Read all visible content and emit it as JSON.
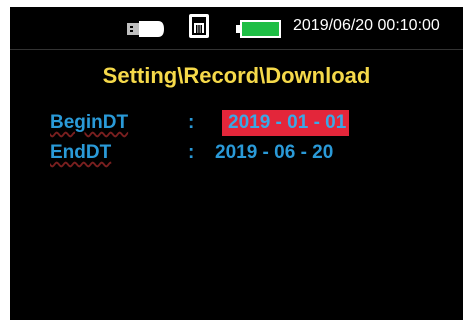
{
  "status_bar": {
    "datetime": "2019/06/20 00:10:00",
    "icons": [
      "usb-drive-icon",
      "sim-card-icon",
      "battery-icon"
    ]
  },
  "page": {
    "title": "Setting\\Record\\Download"
  },
  "fields": [
    {
      "label": "BeginDT",
      "separator": ":",
      "value": "2019 - 01 - 01",
      "selected": true
    },
    {
      "label": "EndDT",
      "separator": ":",
      "value": "2019 - 06 - 20",
      "selected": false
    }
  ],
  "colors": {
    "background": "#000000",
    "title": "#f5d94a",
    "label": "#2a9ad8",
    "selection": "#e3263a",
    "battery_fill": "#1fbe45"
  },
  "battery_level": 1.0
}
